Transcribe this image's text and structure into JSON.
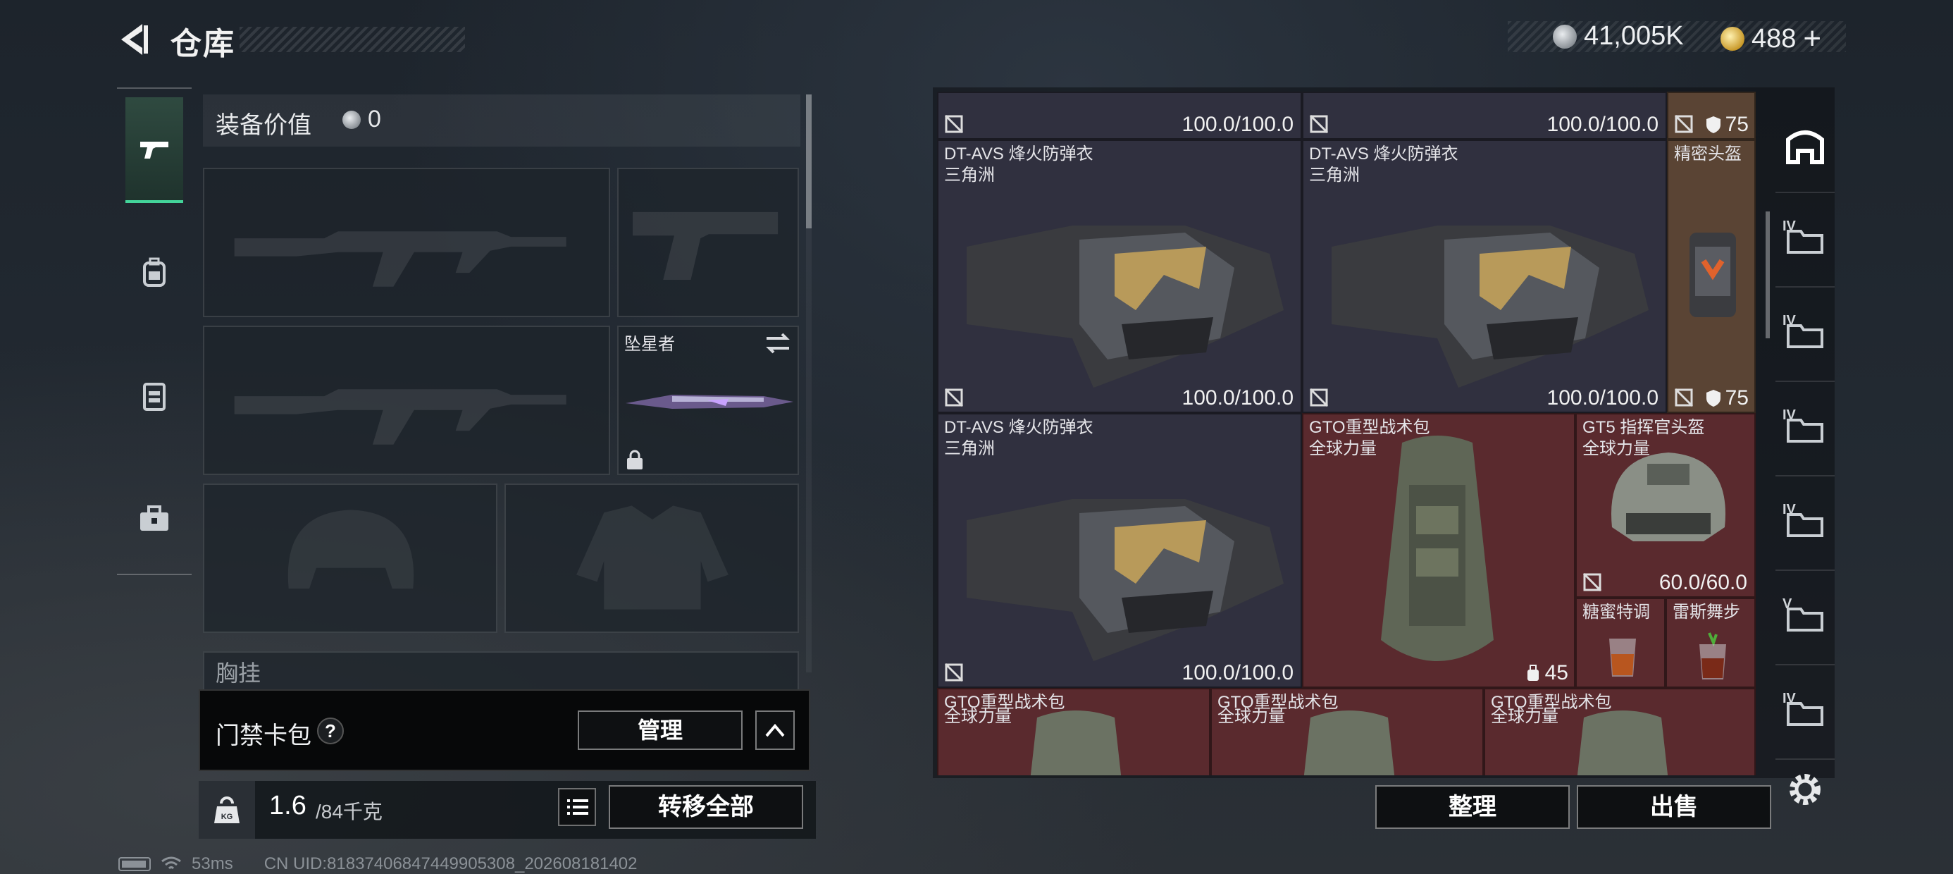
{
  "header": {
    "title": "仓库",
    "currency_silver": "41,005K",
    "currency_gold": "488",
    "currency_gold_add": "+"
  },
  "left_nav": {
    "items": [
      {
        "icon": "pistol-icon",
        "active": true
      },
      {
        "icon": "backpack-icon",
        "active": false
      },
      {
        "icon": "vest-icon",
        "active": false
      },
      {
        "icon": "toolbox-icon",
        "active": false
      }
    ]
  },
  "equipment": {
    "value_label": "装备价值",
    "value": "0",
    "melee_name": "坠星者",
    "chest_label": "胸挂",
    "chest_help": "?"
  },
  "keycard": {
    "label": "门禁卡包",
    "help": "?",
    "manage_label": "管理"
  },
  "weight": {
    "current": "1.6",
    "max": "/84千克",
    "kg_icon_text": "KG",
    "transfer_label": "转移全部"
  },
  "storage": {
    "top_row": [
      {
        "durability": "100.0/100.0"
      },
      {
        "durability": "100.0/100.0"
      },
      {
        "armor": "75"
      }
    ],
    "items": [
      {
        "name": "DT-AVS 烽火防弹衣",
        "sub": "三角洲",
        "durability": "100.0/100.0"
      },
      {
        "name": "DT-AVS 烽火防弹衣",
        "sub": "三角洲",
        "durability": "100.0/100.0"
      },
      {
        "name": "精密头盔",
        "sub": "",
        "armor": "75"
      },
      {
        "name": "DT-AVS 烽火防弹衣",
        "sub": "三角洲",
        "durability": "100.0/100.0"
      },
      {
        "name": "GTO重型战术包",
        "sub": "全球力量",
        "capacity": "45"
      },
      {
        "name": "GT5 指挥官头盔",
        "sub": "全球力量",
        "durability": "60.0/60.0"
      },
      {
        "name": "糖蜜特调",
        "sub": ""
      },
      {
        "name": "雷斯舞步",
        "sub": ""
      },
      {
        "name": "GTO重型战术包",
        "sub": "全球力量"
      },
      {
        "name": "GTO重型战术包",
        "sub": "全球力量"
      },
      {
        "name": "GTO重型战术包",
        "sub": "全球力量"
      }
    ],
    "sort_label": "整理",
    "sell_label": "出售"
  },
  "right_nav": {
    "items": [
      {
        "icon": "home-storage-icon",
        "label": ""
      },
      {
        "icon": "folder-iv-icon",
        "label": "IV"
      },
      {
        "icon": "folder-iv-icon",
        "label": "IV"
      },
      {
        "icon": "folder-iv-icon",
        "label": "IV"
      },
      {
        "icon": "folder-iv-icon",
        "label": "IV"
      },
      {
        "icon": "folder-v-icon",
        "label": "V"
      },
      {
        "icon": "folder-iv-icon",
        "label": "IV"
      }
    ]
  },
  "status": {
    "ping": "53ms",
    "uid": "CN UID:81837406847449905308_202608181402"
  },
  "colors": {
    "accent": "#43d49a",
    "cell_dark": "#30303f",
    "cell_red": "#5a2a2e",
    "cell_tan": "#5a4434"
  }
}
